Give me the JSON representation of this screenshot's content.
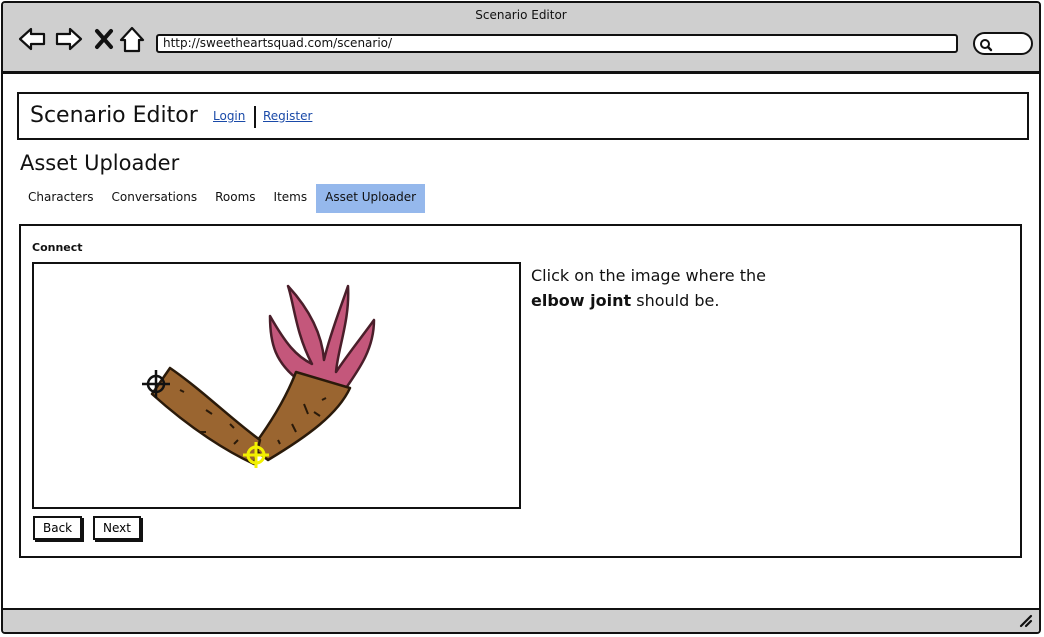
{
  "window": {
    "title": "Scenario Editor"
  },
  "browser": {
    "url": "http://sweetheartsquad.com/scenario/"
  },
  "header": {
    "app_title": "Scenario Editor",
    "login_label": "Login",
    "register_label": "Register"
  },
  "page": {
    "title": "Asset Uploader"
  },
  "tabs": [
    {
      "label": "Characters",
      "active": false
    },
    {
      "label": "Conversations",
      "active": false
    },
    {
      "label": "Rooms",
      "active": false
    },
    {
      "label": "Items",
      "active": false
    },
    {
      "label": "Asset Uploader",
      "active": true
    }
  ],
  "panel": {
    "label": "Connect",
    "instruction_pre": "Click on the image where the",
    "instruction_bold": "elbow joint",
    "instruction_post": "should be.",
    "back_label": "Back",
    "next_label": "Next"
  },
  "colors": {
    "active_tab": "#95b8ec",
    "arm_brown": "#9a6530",
    "hand_pink": "#c4577b",
    "joint_marker": "#f2f000",
    "link": "#1a4aa8"
  },
  "icons": [
    "back-arrow-icon",
    "forward-arrow-icon",
    "close-icon",
    "home-icon",
    "search-icon",
    "resize-grip-icon",
    "crosshair-icon"
  ]
}
